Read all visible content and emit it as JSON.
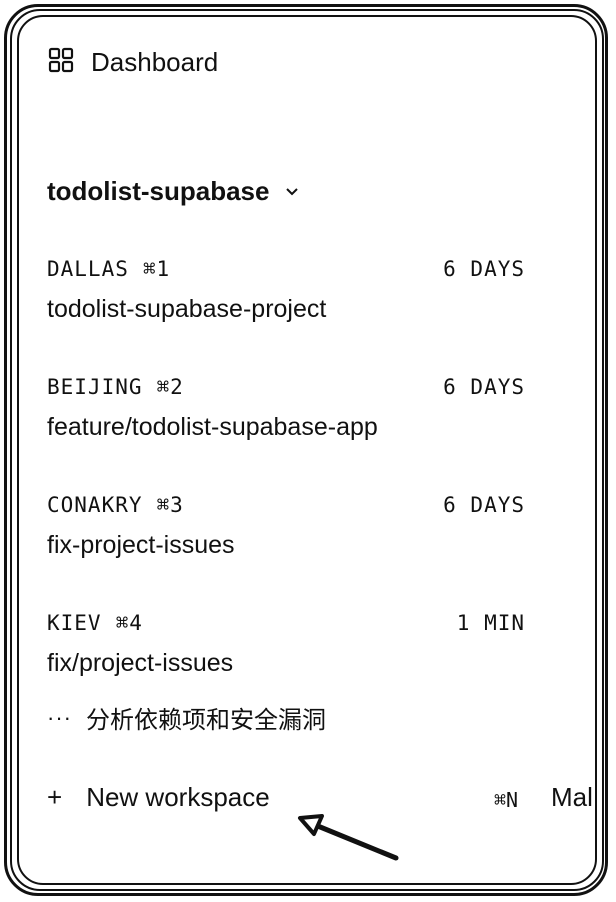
{
  "header": {
    "dashboard_label": "Dashboard",
    "dashboard_icon": "grid-icon"
  },
  "project": {
    "name": "todolist-supabase",
    "chevron_icon": "chevron-down-icon"
  },
  "workspaces": [
    {
      "location": "DALLAS",
      "shortcut": "⌘1",
      "age": "6 DAYS",
      "title": "todolist-supabase-project"
    },
    {
      "location": "BEIJING",
      "shortcut": "⌘2",
      "age": "6 DAYS",
      "title": "feature/todolist-supabase-app"
    },
    {
      "location": "CONAKRY",
      "shortcut": "⌘3",
      "age": "6 DAYS",
      "title": "fix-project-issues"
    },
    {
      "location": "KIEV",
      "shortcut": "⌘4",
      "age": "1 MIN",
      "title": "fix/project-issues"
    }
  ],
  "activity": {
    "dots": "···",
    "text": "分析依赖项和安全漏洞"
  },
  "footer": {
    "plus": "+",
    "new_workspace_label": "New workspace",
    "shortcut": "⌘N",
    "overflow_text": "Mal"
  }
}
